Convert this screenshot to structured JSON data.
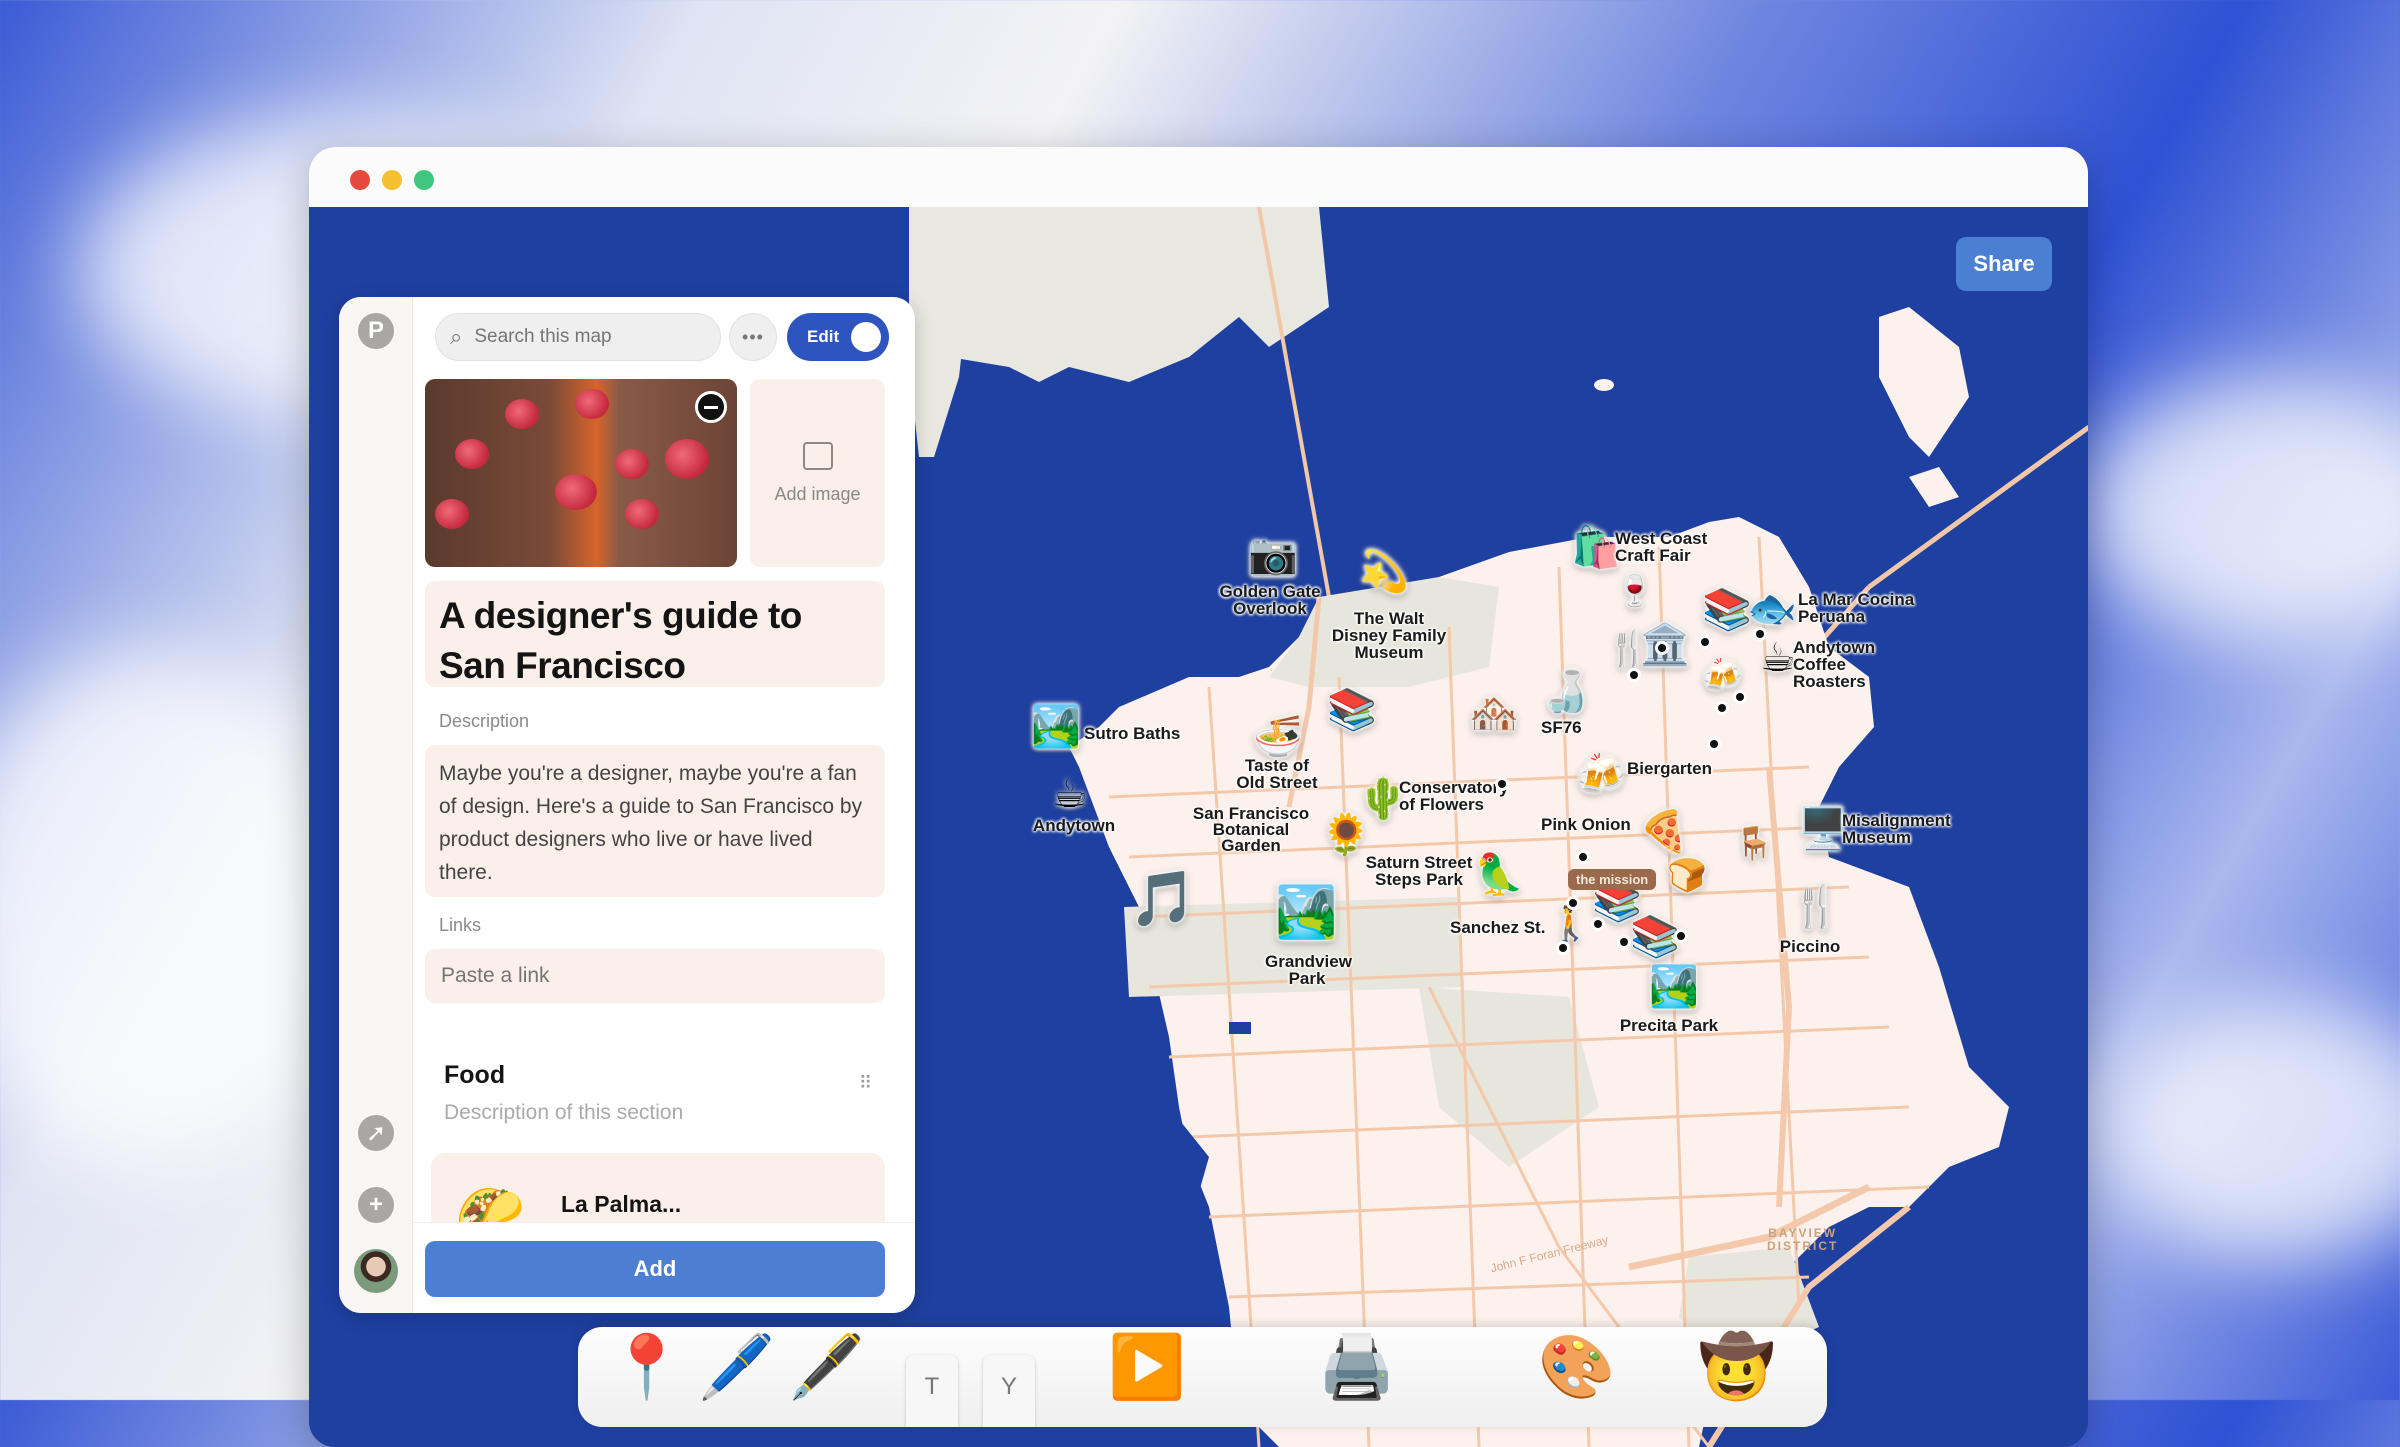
{
  "window": {
    "traffic_lights": {
      "close": "#e5483c",
      "minimize": "#f6bf2f",
      "zoom": "#3fc77f"
    }
  },
  "toolbar": {
    "share_label": "Share"
  },
  "sidebar": {
    "logo_icon": "P",
    "items": [
      {
        "name": "explore",
        "icon": "compass-icon"
      },
      {
        "name": "create",
        "icon": "plus-icon"
      },
      {
        "name": "profile",
        "icon": "avatar"
      }
    ]
  },
  "panel": {
    "search": {
      "placeholder": "Search this map"
    },
    "more_label": "•••",
    "edit_label": "Edit",
    "edit_toggle_on": true,
    "add_image_label": "Add image",
    "title": "A designer's guide to San Francisco",
    "description_label": "Description",
    "description": "Maybe you're a designer, maybe you're a fan of design. Here's a guide to San Francisco by product designers who live or have lived there.",
    "links_label": "Links",
    "links_placeholder": "Paste a link",
    "section": {
      "title": "Food",
      "description_placeholder": "Description of this section"
    },
    "items": [
      {
        "name": "La Palma...",
        "emoji": "🌮"
      }
    ],
    "add_label": "Add"
  },
  "map": {
    "places": [
      {
        "name": "Golden Gate Overlook",
        "emoji": "📷"
      },
      {
        "name": "The Walt Disney Family Museum",
        "emoji": "💫"
      },
      {
        "name": "West Coast Craft Fair",
        "emoji": "🛍️"
      },
      {
        "name": "La Mar Cocina Peruana",
        "emoji": "🐟"
      },
      {
        "name": "Andytown Coffee Roasters",
        "emoji": "☕"
      },
      {
        "name": "Sutro Baths",
        "emoji": "🏞️"
      },
      {
        "name": "Taste of Old Street",
        "emoji": "🍜"
      },
      {
        "name": "SF76",
        "emoji": "🍶"
      },
      {
        "name": "Biergarten",
        "emoji": "🍻"
      },
      {
        "name": "Conservatory of Flowers",
        "emoji": "🌵"
      },
      {
        "name": "Andytown",
        "emoji": "☕"
      },
      {
        "name": "San Francisco Botanical Garden",
        "emoji": "🌻"
      },
      {
        "name": "Pink Onion",
        "emoji": "🍕"
      },
      {
        "name": "Misalignment Museum",
        "emoji": "🖥️"
      },
      {
        "name": "Saturn Street Steps Park",
        "emoji": "🦜"
      },
      {
        "name": "Sanchez St.",
        "emoji": "🚶"
      },
      {
        "name": "Grandview Park",
        "emoji": "🏞️"
      },
      {
        "name": "Piccino",
        "emoji": "🍴"
      },
      {
        "name": "Precita Park",
        "emoji": "🏞️"
      }
    ],
    "unlabeled_markers": [
      "📚",
      "📚",
      "📚",
      "📚",
      "🏛️",
      "🍷",
      "🍴",
      "🍻",
      "🏘️",
      "🍞",
      "🪑",
      "🎵"
    ],
    "neighborhood_tag": "the mission",
    "district_label": "BAYVIEW\nDISTRICT",
    "district_line1": "BAYVIEW",
    "district_line2": "DISTRICT",
    "road_label": "John F Foran Freeway"
  },
  "dock": {
    "apps": [
      "📍",
      "🖊️",
      "🖋️",
      "T",
      "Y",
      "▶️",
      "🖨️",
      "🎨",
      "🤠"
    ]
  }
}
